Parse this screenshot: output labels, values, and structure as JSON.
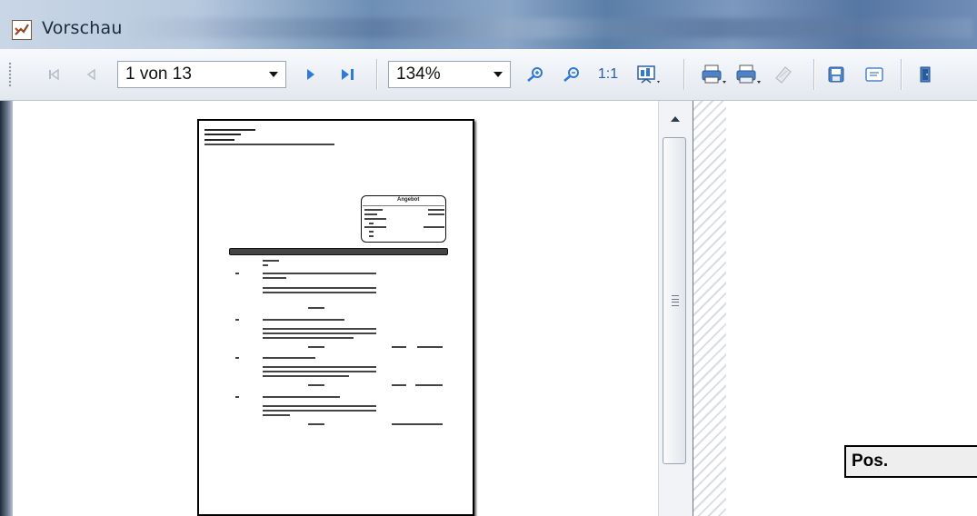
{
  "window": {
    "title": "Vorschau",
    "icon": "preview-app-icon"
  },
  "toolbar": {
    "page_selector": {
      "value": "1 von 13"
    },
    "zoom_selector": {
      "value": "134%"
    },
    "actual_size_label": "1:1",
    "icons": [
      "first-page-icon",
      "previous-page-icon",
      "next-page-icon",
      "last-page-icon",
      "zoom-in-icon",
      "zoom-out-icon",
      "fit-page-icon",
      "print-icon",
      "print-setup-icon",
      "print-selection-icon",
      "save-icon",
      "export-icon",
      "exit-icon"
    ]
  },
  "preview": {
    "document_page": {
      "box_title": "Angebot"
    },
    "scrollbar": {
      "up_arrow": "scroll-up-icon"
    }
  },
  "right_pane": {
    "column_header": "Pos."
  }
}
